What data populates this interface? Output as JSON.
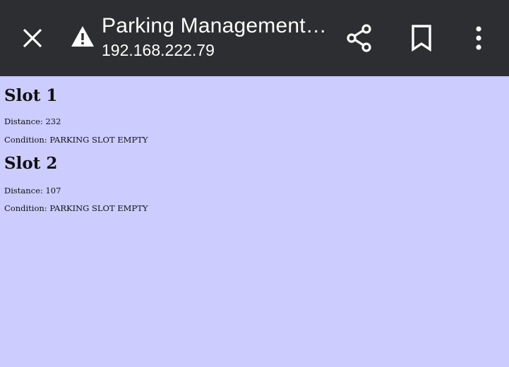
{
  "browser": {
    "title": "Parking Management System",
    "url": "192.168.222.79",
    "icons": {
      "close": "close-icon",
      "warning": "warning-icon",
      "share": "share-icon",
      "bookmark": "bookmark-icon",
      "menu": "more-vert-icon"
    },
    "colors": {
      "toolbar_bg": "#2d2e31",
      "toolbar_text": "#ffffff",
      "page_bg": "#ccccff"
    }
  },
  "page": {
    "slots": [
      {
        "heading": "Slot 1",
        "distance": "Distance: 232",
        "condition": "Condition: PARKING SLOT EMPTY"
      },
      {
        "heading": "Slot 2",
        "distance": "Distance: 107",
        "condition": "Condition: PARKING SLOT EMPTY"
      }
    ]
  }
}
